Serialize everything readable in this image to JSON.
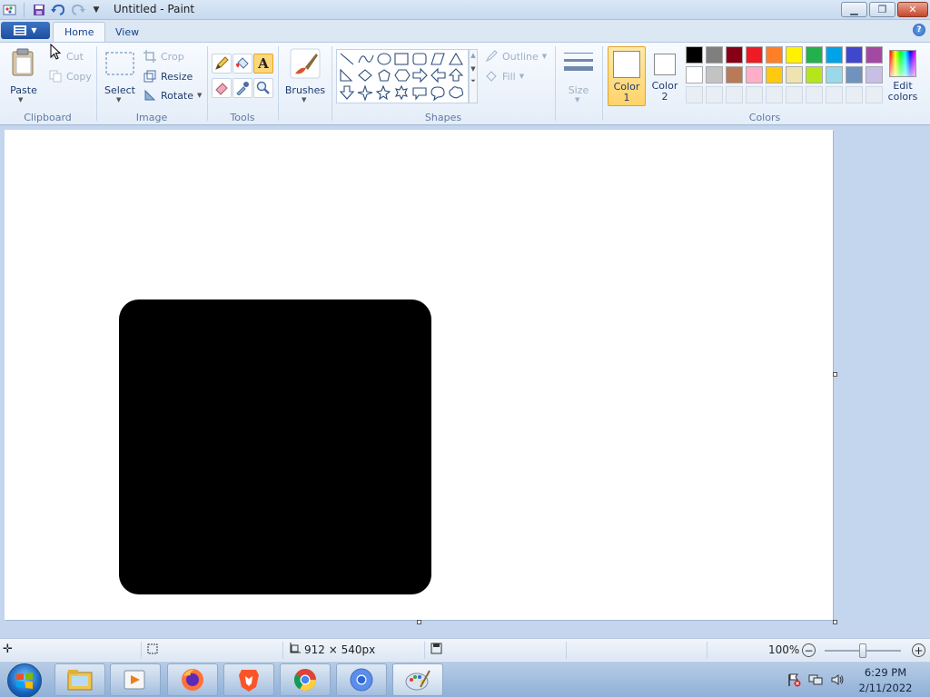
{
  "window": {
    "title": "Untitled - Paint",
    "qat_icons": [
      "paint-app-icon",
      "save-icon",
      "undo-icon",
      "redo-icon",
      "customize-qat-icon"
    ]
  },
  "tabs": [
    {
      "label": "Home",
      "selected": true
    },
    {
      "label": "View",
      "selected": false
    }
  ],
  "ribbon": {
    "clipboard": {
      "label": "Clipboard",
      "paste": "Paste",
      "cut": "Cut",
      "copy": "Copy"
    },
    "image": {
      "label": "Image",
      "select": "Select",
      "crop": "Crop",
      "resize": "Resize",
      "rotate": "Rotate"
    },
    "tools": {
      "label": "Tools",
      "items": [
        "pencil-icon",
        "fill-icon",
        "text-icon",
        "eraser-icon",
        "color-picker-icon",
        "magnifier-icon"
      ],
      "active": "text-icon"
    },
    "brushes": {
      "label": "Brushes"
    },
    "shapes": {
      "label": "Shapes",
      "outline": "Outline",
      "fill": "Fill"
    },
    "size": {
      "label": "Size"
    },
    "colors": {
      "label": "Colors",
      "color1_line1": "Color",
      "color1_line2": "1",
      "color2_line1": "Color",
      "color2_line2": "2",
      "edit_line1": "Edit",
      "edit_line2": "colors",
      "color1": "#ffffff",
      "color2": "#ffffff",
      "palette_row1": [
        "#000000",
        "#7f7f7f",
        "#880015",
        "#ed1c24",
        "#ff7f27",
        "#fff200",
        "#22b14c",
        "#00a2e8",
        "#3f48cc",
        "#a349a4"
      ],
      "palette_row2": [
        "#ffffff",
        "#c3c3c3",
        "#b97a57",
        "#ffaec9",
        "#ffc90e",
        "#efe4b0",
        "#b5e61d",
        "#99d9ea",
        "#7092be",
        "#c8bfe7"
      ]
    }
  },
  "canvas": {
    "shape": "rounded-rectangle",
    "shape_color": "#000000"
  },
  "status": {
    "canvas_size": "912 × 540px",
    "zoom": "100%",
    "zoom_fraction": 0.5
  },
  "taskbar": {
    "items": [
      "file-explorer-icon",
      "media-player-icon",
      "firefox-icon",
      "brave-icon",
      "chrome-icon",
      "chromium-icon",
      "paint-icon"
    ],
    "active": "paint-icon",
    "time": "6:29 PM",
    "date": "2/11/2022"
  }
}
